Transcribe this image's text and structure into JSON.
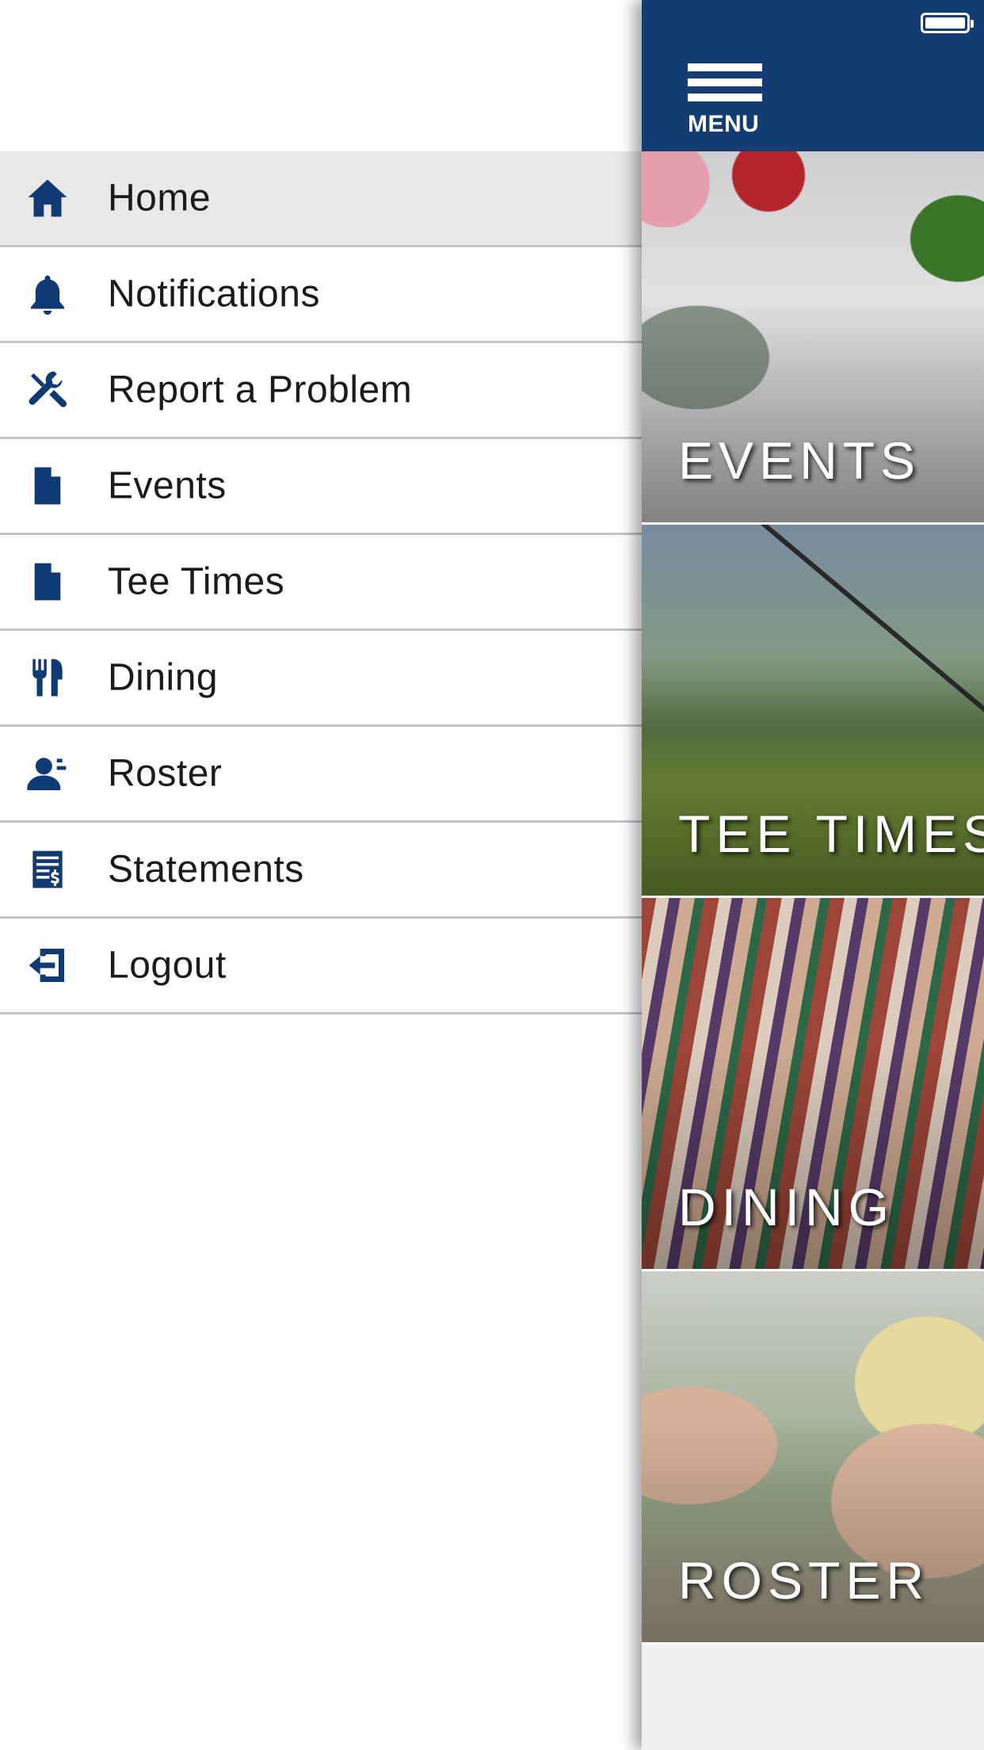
{
  "menu": {
    "items": [
      {
        "label": "Home",
        "icon": "home-icon",
        "active": true
      },
      {
        "label": "Notifications",
        "icon": "bell-icon"
      },
      {
        "label": "Report a Problem",
        "icon": "tools-icon"
      },
      {
        "label": "Events",
        "icon": "document-icon"
      },
      {
        "label": "Tee Times",
        "icon": "document-icon"
      },
      {
        "label": "Dining",
        "icon": "utensils-icon"
      },
      {
        "label": "Roster",
        "icon": "person-icon"
      },
      {
        "label": "Statements",
        "icon": "statement-icon"
      },
      {
        "label": "Logout",
        "icon": "logout-icon"
      }
    ]
  },
  "topbar": {
    "menu_label": "MENU"
  },
  "tiles": [
    {
      "label": "EVENTS"
    },
    {
      "label": "TEE TIMES"
    },
    {
      "label": "DINING"
    },
    {
      "label": "ROSTER"
    }
  ],
  "colors": {
    "brand": "#133d73",
    "icon": "#0f3a73",
    "active_row": "#e8e8e8"
  }
}
